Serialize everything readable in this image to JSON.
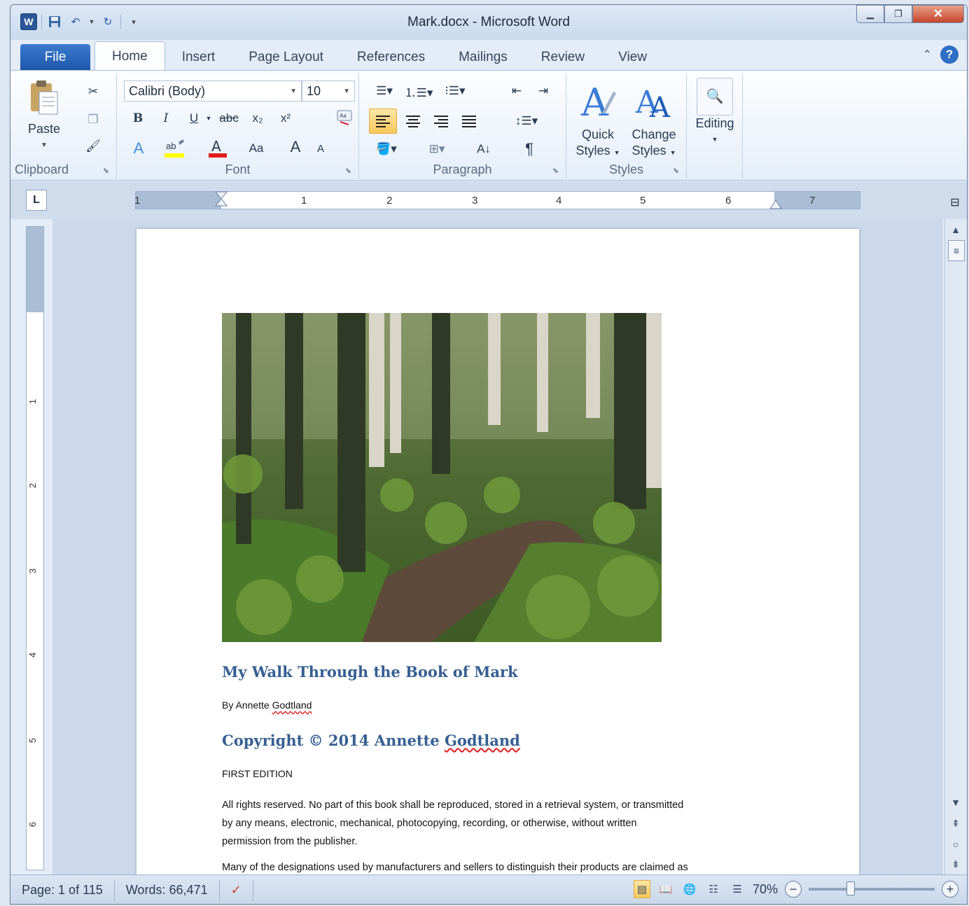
{
  "app": {
    "title": "Mark.docx - Microsoft Word",
    "qat_icons": [
      "word-logo-icon",
      "save-icon",
      "undo-icon",
      "redo-icon",
      "customize-qat-icon"
    ],
    "word_logo": "W"
  },
  "tabs": [
    "File",
    "Home",
    "Insert",
    "Page Layout",
    "References",
    "Mailings",
    "Review",
    "View"
  ],
  "active_tab": "Home",
  "ribbon": {
    "clipboard": {
      "label": "Clipboard",
      "paste": "Paste"
    },
    "font": {
      "label": "Font",
      "font_name": "Calibri (Body)",
      "font_size": "10",
      "bold": "B",
      "italic": "I",
      "underline": "U",
      "strike": "abc",
      "subscript": "x₂",
      "superscript": "x²",
      "case": "Aa",
      "grow": "A",
      "shrink": "A"
    },
    "paragraph": {
      "label": "Paragraph"
    },
    "styles": {
      "label": "Styles",
      "quick_styles": "Quick",
      "quick_styles_2": "Styles",
      "change_styles": "Change",
      "change_styles_2": "Styles"
    },
    "editing": {
      "label": "Editing"
    }
  },
  "ruler": {
    "numbers": [
      "1",
      "1",
      "2",
      "3",
      "4",
      "5",
      "6",
      "7"
    ],
    "vertical_numbers": [
      "1",
      "2",
      "3",
      "4",
      "5",
      "6"
    ],
    "tab_selector": "L"
  },
  "document": {
    "title": "My Walk Through the Book of Mark",
    "author_line_prefix": "By Annette ",
    "author_surname": "Godtland",
    "copyright_prefix": "Copyright © 2014 Annette ",
    "copyright_surname": "Godtland",
    "edition": "FIRST EDITION",
    "rights_line_1": "All rights reserved. No part of this book shall be reproduced, stored in a retrieval system, or transmitted",
    "rights_line_2": "by any means, electronic, mechanical, photocopying, recording, or otherwise, without written",
    "rights_line_3": "permission from the publisher.",
    "designations": "Many of the designations used by manufacturers and sellers to distinguish their products are claimed as",
    "image": "forest-trail-photo"
  },
  "status": {
    "page": "Page: 1 of 115",
    "words": "Words: 66,471",
    "zoom": "70%",
    "zoom_level": 0.7
  }
}
